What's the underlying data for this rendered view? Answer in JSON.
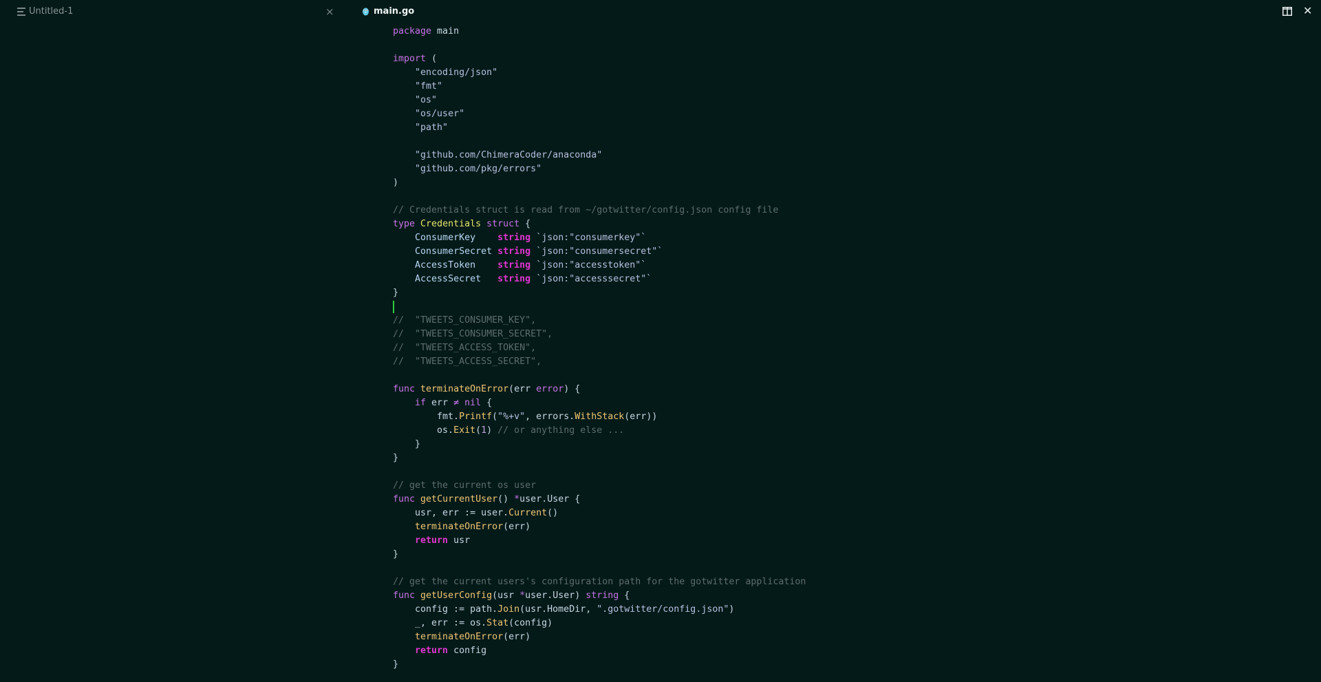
{
  "left_tab": {
    "title": "Untitled-1",
    "close": "×"
  },
  "right_tab": {
    "title": "main.go",
    "close": "✕"
  },
  "code_lines": [
    [
      [
        "kw",
        "package"
      ],
      [
        "id",
        " main"
      ]
    ],
    [],
    [
      [
        "kw",
        "import"
      ],
      [
        "id",
        " ("
      ]
    ],
    [
      [
        "id",
        "    "
      ],
      [
        "str",
        "\"encoding/json\""
      ]
    ],
    [
      [
        "id",
        "    "
      ],
      [
        "str",
        "\"fmt\""
      ]
    ],
    [
      [
        "id",
        "    "
      ],
      [
        "str",
        "\"os\""
      ]
    ],
    [
      [
        "id",
        "    "
      ],
      [
        "str",
        "\"os/user\""
      ]
    ],
    [
      [
        "id",
        "    "
      ],
      [
        "str",
        "\"path\""
      ]
    ],
    [],
    [
      [
        "id",
        "    "
      ],
      [
        "str",
        "\"github.com/ChimeraCoder/anaconda\""
      ]
    ],
    [
      [
        "id",
        "    "
      ],
      [
        "str",
        "\"github.com/pkg/errors\""
      ]
    ],
    [
      [
        "id",
        ")"
      ]
    ],
    [],
    [
      [
        "com",
        "// Credentials struct is read from ~/gotwitter/config.json config file"
      ]
    ],
    [
      [
        "kw",
        "type"
      ],
      [
        "id",
        " "
      ],
      [
        "type",
        "Credentials"
      ],
      [
        "id",
        " "
      ],
      [
        "kw",
        "struct"
      ],
      [
        "id",
        " {"
      ]
    ],
    [
      [
        "id",
        "    "
      ],
      [
        "field",
        "ConsumerKey"
      ],
      [
        "id",
        "    "
      ],
      [
        "kw2",
        "string"
      ],
      [
        "id",
        " "
      ],
      [
        "str",
        "`json:\"consumerkey\"`"
      ]
    ],
    [
      [
        "id",
        "    "
      ],
      [
        "field",
        "ConsumerSecret"
      ],
      [
        "id",
        " "
      ],
      [
        "kw2",
        "string"
      ],
      [
        "id",
        " "
      ],
      [
        "str",
        "`json:\"consumersecret\"`"
      ]
    ],
    [
      [
        "id",
        "    "
      ],
      [
        "field",
        "AccessToken"
      ],
      [
        "id",
        "    "
      ],
      [
        "kw2",
        "string"
      ],
      [
        "id",
        " "
      ],
      [
        "str",
        "`json:\"accesstoken\"`"
      ]
    ],
    [
      [
        "id",
        "    "
      ],
      [
        "field",
        "AccessSecret"
      ],
      [
        "id",
        "   "
      ],
      [
        "kw2",
        "string"
      ],
      [
        "id",
        " "
      ],
      [
        "str",
        "`json:\"accesssecret\"`"
      ]
    ],
    [
      [
        "id",
        "}"
      ]
    ],
    [],
    [
      [
        "com",
        "//  \"TWEETS_CONSUMER_KEY\","
      ]
    ],
    [
      [
        "com",
        "//  \"TWEETS_CONSUMER_SECRET\","
      ]
    ],
    [
      [
        "com",
        "//  \"TWEETS_ACCESS_TOKEN\","
      ]
    ],
    [
      [
        "com",
        "//  \"TWEETS_ACCESS_SECRET\","
      ]
    ],
    [],
    [
      [
        "kw",
        "func"
      ],
      [
        "id",
        " "
      ],
      [
        "fn",
        "terminateOnError"
      ],
      [
        "id",
        "(err "
      ],
      [
        "kw",
        "error"
      ],
      [
        "id",
        ") {"
      ]
    ],
    [
      [
        "id",
        "    "
      ],
      [
        "kw",
        "if"
      ],
      [
        "id",
        " err "
      ],
      [
        "op",
        "≠"
      ],
      [
        "id",
        " "
      ],
      [
        "kw",
        "nil"
      ],
      [
        "id",
        " {"
      ]
    ],
    [
      [
        "id",
        "        fmt."
      ],
      [
        "fn",
        "Printf"
      ],
      [
        "id",
        "("
      ],
      [
        "str",
        "\"%+v\""
      ],
      [
        "id",
        ", errors."
      ],
      [
        "fn",
        "WithStack"
      ],
      [
        "id",
        "(err))"
      ]
    ],
    [
      [
        "id",
        "        os."
      ],
      [
        "fn",
        "Exit"
      ],
      [
        "id",
        "("
      ],
      [
        "num",
        "1"
      ],
      [
        "id",
        ") "
      ],
      [
        "com",
        "// or anything else ..."
      ]
    ],
    [
      [
        "id",
        "    }"
      ]
    ],
    [
      [
        "id",
        "}"
      ]
    ],
    [],
    [
      [
        "com",
        "// get the current os user"
      ]
    ],
    [
      [
        "kw",
        "func"
      ],
      [
        "id",
        " "
      ],
      [
        "fn",
        "getCurrentUser"
      ],
      [
        "id",
        "() "
      ],
      [
        "op",
        "*"
      ],
      [
        "id",
        "user.User {"
      ]
    ],
    [
      [
        "id",
        "    usr, err := user."
      ],
      [
        "fn",
        "Current"
      ],
      [
        "id",
        "()"
      ]
    ],
    [
      [
        "id",
        "    "
      ],
      [
        "fn",
        "terminateOnError"
      ],
      [
        "id",
        "(err)"
      ]
    ],
    [
      [
        "id",
        "    "
      ],
      [
        "kw2",
        "return"
      ],
      [
        "id",
        " usr"
      ]
    ],
    [
      [
        "id",
        "}"
      ]
    ],
    [],
    [
      [
        "com",
        "// get the current users's configuration path for the gotwitter application"
      ]
    ],
    [
      [
        "kw",
        "func"
      ],
      [
        "id",
        " "
      ],
      [
        "fn",
        "getUserConfig"
      ],
      [
        "id",
        "(usr "
      ],
      [
        "op",
        "*"
      ],
      [
        "id",
        "user.User) "
      ],
      [
        "kw",
        "string"
      ],
      [
        "id",
        " {"
      ]
    ],
    [
      [
        "id",
        "    config := path."
      ],
      [
        "fn",
        "Join"
      ],
      [
        "id",
        "(usr.HomeDir, "
      ],
      [
        "str",
        "\".gotwitter/config.json\""
      ],
      [
        "id",
        ")"
      ]
    ],
    [
      [
        "id",
        "    _, err := os."
      ],
      [
        "fn",
        "Stat"
      ],
      [
        "id",
        "(config)"
      ]
    ],
    [
      [
        "id",
        "    "
      ],
      [
        "fn",
        "terminateOnError"
      ],
      [
        "id",
        "(err)"
      ]
    ],
    [
      [
        "id",
        "    "
      ],
      [
        "kw2",
        "return"
      ],
      [
        "id",
        " config"
      ]
    ],
    [
      [
        "id",
        "}"
      ]
    ]
  ],
  "cursor_line": 20,
  "icons": {
    "left_tab": "file-lines-icon",
    "right_tab": "go-gopher-icon",
    "split": "split-editor-icon"
  },
  "colors": {
    "background": "#041a18",
    "cursor": "#2ecc40"
  }
}
